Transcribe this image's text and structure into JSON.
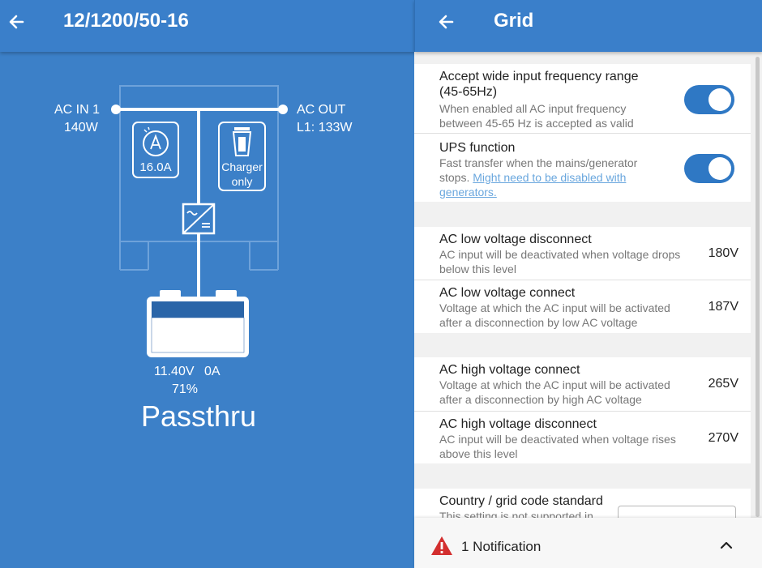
{
  "left": {
    "title": "12/1200/50-16",
    "ac_in": {
      "label": "AC IN 1",
      "power": "140W"
    },
    "ac_out": {
      "label": "AC OUT",
      "power": "L1: 133W"
    },
    "current_limit": "16.0A",
    "charger_mode": {
      "line1": "Charger",
      "line2": "only"
    },
    "battery": {
      "voltage": "11.40V",
      "current": "0A",
      "soc": "71%"
    },
    "state": "Passthru"
  },
  "right": {
    "title": "Grid",
    "settings": {
      "wide_freq": {
        "title_line1": "Accept wide input frequency range",
        "title_line2": "(45-65Hz)",
        "desc_line1": "When enabled all AC input frequency",
        "desc_line2": "between 45-65 Hz is accepted as valid",
        "enabled": true
      },
      "ups": {
        "title": "UPS function",
        "desc_line1": "Fast transfer when the mains/generator",
        "desc_prefix": "stops. ",
        "link_part1": "Might need to be disabled with",
        "link_part2": "generators.",
        "enabled": true
      },
      "ac_low_disconnect": {
        "title": "AC low voltage disconnect",
        "desc_line1": "AC input will be deactivated when voltage drops",
        "desc_line2": "below this level",
        "value": "180V"
      },
      "ac_low_connect": {
        "title": "AC low voltage connect",
        "desc_line1": "Voltage at which the AC input will be activated",
        "desc_line2": "after a disconnection by low AC voltage",
        "value": "187V"
      },
      "ac_high_connect": {
        "title": "AC high voltage connect",
        "desc_line1": "Voltage at which the AC input will be activated",
        "desc_line2": "after a disconnection by high AC voltage",
        "value": "265V"
      },
      "ac_high_disconnect": {
        "title": "AC high voltage disconnect",
        "desc_line1": "AC input will be deactivated when voltage rises",
        "desc_line2": "above this level",
        "value": "270V"
      },
      "grid_code": {
        "title": "Country / grid code standard",
        "desc_line1": "This setting is not supported in"
      }
    },
    "notification": {
      "text": "1 Notification"
    }
  },
  "colors": {
    "header": "#3a7fca",
    "panel": "#3c80c8",
    "toggle": "#2f78c4",
    "warning": "#d32f2f",
    "link": "#6aa7de"
  }
}
